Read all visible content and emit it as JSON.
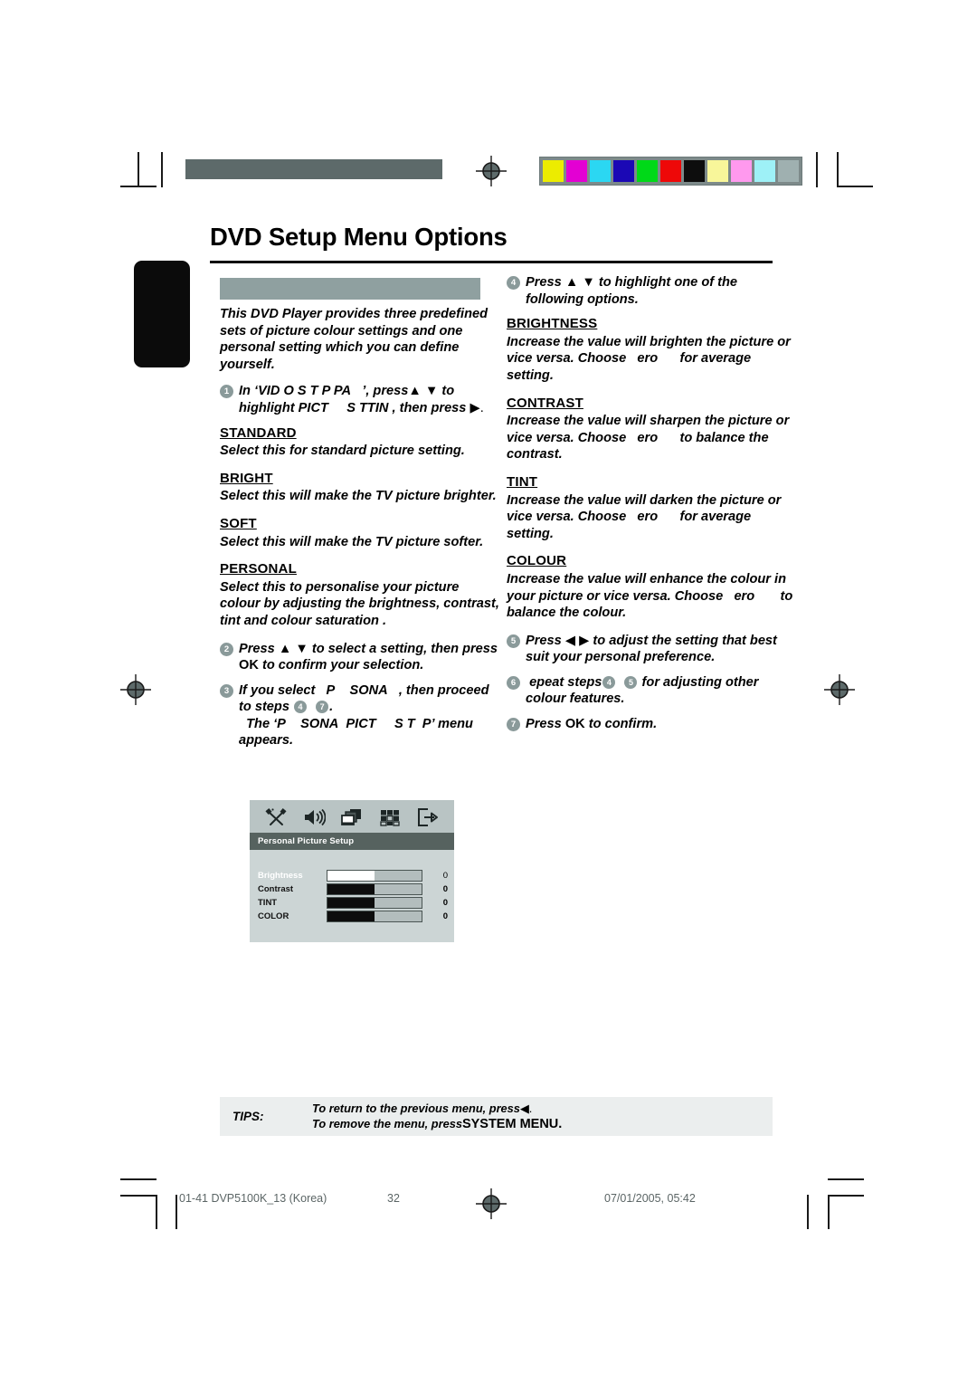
{
  "page_title": "DVD Setup Menu Options",
  "section_bar_label": "",
  "left_column": {
    "intro": "This DVD Player provides three predefined sets of picture colour settings and one personal setting which you can define yourself.",
    "step1": {
      "num": "1",
      "text_a": "In ‘VID",
      "text_b": "O S",
      "text_c": "T",
      "text_d": "P PA",
      "text_e": "’, press",
      "text_f": "to highlight",
      "text_g": "PICT",
      "text_h": "S",
      "text_i": "TTIN",
      "text_j": ", then press",
      "text_k": "▶."
    },
    "options": [
      {
        "heading": "STANDARD",
        "body": "Select this for standard picture setting."
      },
      {
        "heading": "BRIGHT",
        "body": "Select this will make the TV picture brighter."
      },
      {
        "heading": "SOFT",
        "body": "Select this will make the TV picture softer."
      },
      {
        "heading": "PERSONAL",
        "body": "Select this to personalise your picture colour by adjusting the brightness, contrast, tint and colour  saturation ."
      }
    ],
    "step2": {
      "num": "2",
      "text_a": "Press",
      "text_b": "to select a setting, then press",
      "text_c": "OK",
      "text_d": "to confirm your selection."
    },
    "step3": {
      "num": "3",
      "text_a": "If you select",
      "text_b": "P",
      "text_c": "SONA",
      "text_d": ", then proceed to steps",
      "ref1": "4",
      "ref2": "7",
      "text_e": ".",
      "text_f": "The ‘P",
      "text_g": "SONA",
      "text_h": "PICT",
      "text_i": "S T",
      "text_j": "P’ menu appears."
    }
  },
  "right_column": {
    "step4": {
      "num": "4",
      "text_a": "Press",
      "text_b": "to highlight one of the following options."
    },
    "options": [
      {
        "heading": "BRIGHTNESS",
        "body_a": "Increase the value will brighten the picture or vice versa. Choose",
        "body_b": "ero",
        "body_c": "for average setting."
      },
      {
        "heading": "CONTRAST",
        "body_a": "Increase the value will sharpen the picture or vice versa.  Choose",
        "body_b": "ero",
        "body_c": "to balance the contrast."
      },
      {
        "heading": "TINT",
        "body_a": "Increase the value will darken the picture or vice versa.  Choose",
        "body_b": "ero",
        "body_c": "for average setting."
      },
      {
        "heading": "COLOUR",
        "body_a": "Increase the value will enhance the colour in your picture or vice versa. Choose",
        "body_b": "ero",
        "body_c": "to balance the colour."
      }
    ],
    "step5": {
      "num": "5",
      "text_a": "Press",
      "text_b": "to adjust the setting that best suit your personal preference."
    },
    "step6": {
      "num": "6",
      "text_a": "epeat steps",
      "ref1": "4",
      "ref2": "5",
      "text_b": "for adjusting other colour features."
    },
    "step7": {
      "num": "7",
      "text_a": "Press",
      "text_b": "OK",
      "text_c": "to confirm."
    }
  },
  "osd": {
    "icons": [
      "tools-icon",
      "speaker-icon",
      "video-icon",
      "preference-grid-icon",
      "exit-icon"
    ],
    "title": "Personal Picture Setup",
    "rows": [
      {
        "label": "Brightness",
        "value": "0",
        "fill_pct": 50,
        "selected": true
      },
      {
        "label": "Contrast",
        "value": "0",
        "fill_pct": 50,
        "selected": false
      },
      {
        "label": "TINT",
        "value": "0",
        "fill_pct": 50,
        "selected": false
      },
      {
        "label": "COLOR",
        "value": "0",
        "fill_pct": 50,
        "selected": false
      }
    ]
  },
  "tips": {
    "label": "TIPS:",
    "line1_a": "To return to the previous menu, press",
    "line1_b": "◀.",
    "line2_a": "To remove the menu, press",
    "line2_b": "SYSTEM MENU."
  },
  "footer": {
    "file": "01-41 DVP5100K_13 (Korea)",
    "page": "32",
    "date": "07/01/2005, 05:42"
  },
  "colors": {
    "accent_gray_green": "#8fa0a0",
    "bullet": "#8a9a9a",
    "osd_bg": "#ccd5d5",
    "osd_titlebar": "#56625f",
    "tips_bg": "#ebeeee",
    "swatches": [
      "#ecec00",
      "#e300d3",
      "#2bd7f2",
      "#1b08b5",
      "#00d918",
      "#ee0808",
      "#0d0d0d",
      "#f8f69a",
      "#ff99ee",
      "#9ef1f7",
      "#9fb0b0"
    ]
  }
}
